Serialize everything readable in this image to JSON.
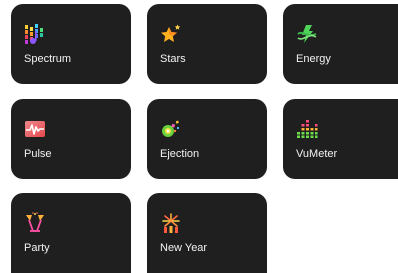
{
  "effects": [
    {
      "label": "Spectrum",
      "icon": "spectrum-icon"
    },
    {
      "label": "Stars",
      "icon": "star-icon"
    },
    {
      "label": "Energy",
      "icon": "energy-icon"
    },
    {
      "label": "Pulse",
      "icon": "pulse-icon"
    },
    {
      "label": "Ejection",
      "icon": "ejection-icon"
    },
    {
      "label": "VuMeter",
      "icon": "vumeter-icon"
    },
    {
      "label": "Party",
      "icon": "party-icon"
    },
    {
      "label": "New Year",
      "icon": "fireworks-icon"
    }
  ],
  "colors": {
    "tile_background": "#1f1f1f",
    "label_text": "#f2f2f2",
    "page_background": "#ffffff"
  }
}
